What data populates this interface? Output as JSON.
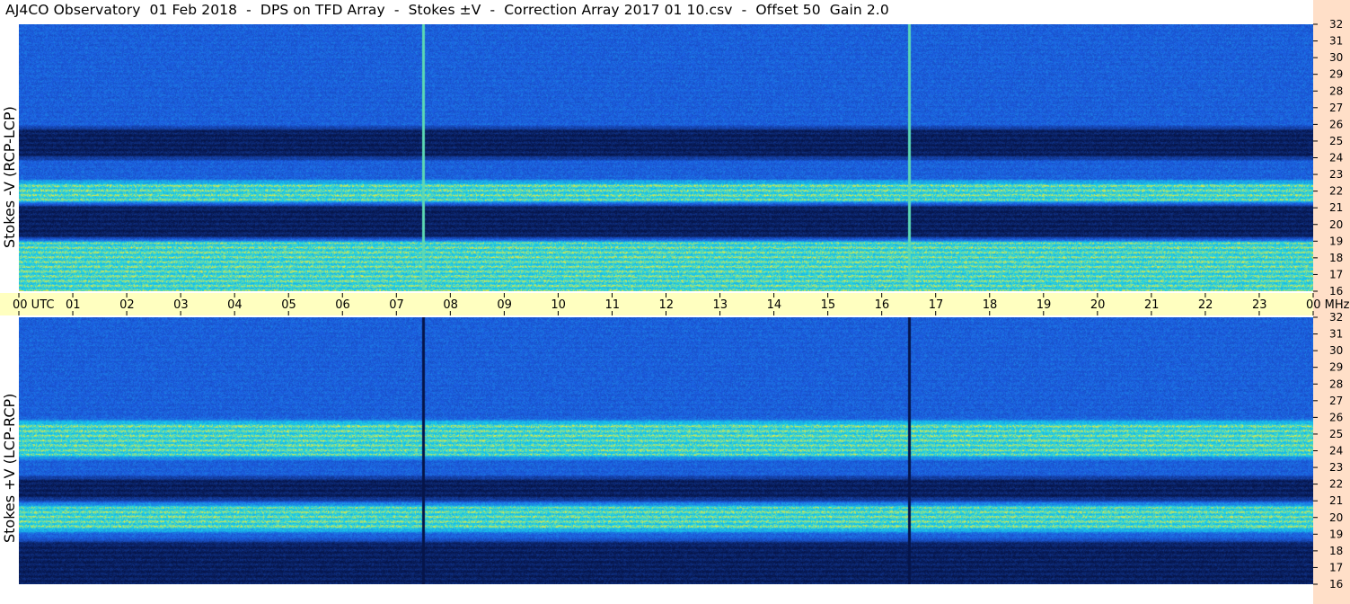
{
  "title": "AJ4CO Observatory  01 Feb 2018  -  DPS on TFD Array  -  Stokes ±V  -  Correction Array 2017 01 10.csv  -  Offset 50  Gain 2.0",
  "chart_data": [
    {
      "type": "heatmap",
      "name": "top-panel",
      "ylabel": "Stokes -V (RCP-LCP)",
      "x_axis": {
        "unit": "UTC",
        "range": [
          0,
          24
        ],
        "tick_labels": [
          "00 UTC",
          "01",
          "02",
          "03",
          "04",
          "05",
          "06",
          "07",
          "08",
          "09",
          "10",
          "11",
          "12",
          "13",
          "14",
          "15",
          "16",
          "17",
          "18",
          "19",
          "20",
          "21",
          "22",
          "23",
          "00 MHz"
        ]
      },
      "y_axis": {
        "unit": "MHz",
        "range": [
          16,
          32
        ],
        "tick_labels": [
          "16",
          "17",
          "18",
          "19",
          "20",
          "21",
          "22",
          "23",
          "24",
          "25",
          "26",
          "27",
          "28",
          "29",
          "30",
          "31",
          "32"
        ]
      },
      "bands": [
        {
          "from_mhz": 24.2,
          "to_mhz": 25.6,
          "level": "low"
        },
        {
          "from_mhz": 21.5,
          "to_mhz": 22.4,
          "level": "high"
        },
        {
          "from_mhz": 19.3,
          "to_mhz": 21.0,
          "level": "low"
        },
        {
          "from_mhz": 16.0,
          "to_mhz": 19.0,
          "level": "high"
        }
      ],
      "vertical_lines_utc": [
        7.5,
        16.5
      ],
      "vertical_line_level": "high"
    },
    {
      "type": "heatmap",
      "name": "bottom-panel",
      "ylabel": "Stokes +V (LCP-RCP)",
      "x_axis": {
        "unit": "UTC",
        "range": [
          0,
          24
        ]
      },
      "y_axis": {
        "unit": "MHz",
        "range": [
          16,
          32
        ],
        "tick_labels": [
          "16",
          "17",
          "18",
          "19",
          "20",
          "21",
          "22",
          "23",
          "24",
          "25",
          "26",
          "27",
          "28",
          "29",
          "30",
          "31",
          "32"
        ]
      },
      "bands": [
        {
          "from_mhz": 23.8,
          "to_mhz": 25.6,
          "level": "high"
        },
        {
          "from_mhz": 21.3,
          "to_mhz": 22.2,
          "level": "low"
        },
        {
          "from_mhz": 19.4,
          "to_mhz": 20.6,
          "level": "high"
        },
        {
          "from_mhz": 16.0,
          "to_mhz": 18.4,
          "level": "low"
        }
      ],
      "vertical_lines_utc": [
        7.5,
        16.5
      ],
      "vertical_line_level": "low"
    }
  ],
  "colors": {
    "base": "#1c5ce0",
    "dark": "#06154a",
    "bright": "#1ad0ea",
    "yellow": "#e0e844",
    "axis_strip": "#ffffc0",
    "freq_strip": "#ffdfc8"
  }
}
